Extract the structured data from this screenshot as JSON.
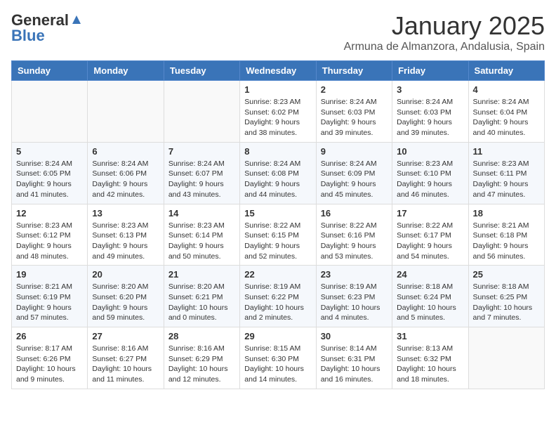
{
  "header": {
    "logo_general": "General",
    "logo_blue": "Blue",
    "month": "January 2025",
    "location": "Armuna de Almanzora, Andalusia, Spain"
  },
  "days_of_week": [
    "Sunday",
    "Monday",
    "Tuesday",
    "Wednesday",
    "Thursday",
    "Friday",
    "Saturday"
  ],
  "weeks": [
    [
      {
        "day": "",
        "info": ""
      },
      {
        "day": "",
        "info": ""
      },
      {
        "day": "",
        "info": ""
      },
      {
        "day": "1",
        "info": "Sunrise: 8:23 AM\nSunset: 6:02 PM\nDaylight: 9 hours and 38 minutes."
      },
      {
        "day": "2",
        "info": "Sunrise: 8:24 AM\nSunset: 6:03 PM\nDaylight: 9 hours and 39 minutes."
      },
      {
        "day": "3",
        "info": "Sunrise: 8:24 AM\nSunset: 6:03 PM\nDaylight: 9 hours and 39 minutes."
      },
      {
        "day": "4",
        "info": "Sunrise: 8:24 AM\nSunset: 6:04 PM\nDaylight: 9 hours and 40 minutes."
      }
    ],
    [
      {
        "day": "5",
        "info": "Sunrise: 8:24 AM\nSunset: 6:05 PM\nDaylight: 9 hours and 41 minutes."
      },
      {
        "day": "6",
        "info": "Sunrise: 8:24 AM\nSunset: 6:06 PM\nDaylight: 9 hours and 42 minutes."
      },
      {
        "day": "7",
        "info": "Sunrise: 8:24 AM\nSunset: 6:07 PM\nDaylight: 9 hours and 43 minutes."
      },
      {
        "day": "8",
        "info": "Sunrise: 8:24 AM\nSunset: 6:08 PM\nDaylight: 9 hours and 44 minutes."
      },
      {
        "day": "9",
        "info": "Sunrise: 8:24 AM\nSunset: 6:09 PM\nDaylight: 9 hours and 45 minutes."
      },
      {
        "day": "10",
        "info": "Sunrise: 8:23 AM\nSunset: 6:10 PM\nDaylight: 9 hours and 46 minutes."
      },
      {
        "day": "11",
        "info": "Sunrise: 8:23 AM\nSunset: 6:11 PM\nDaylight: 9 hours and 47 minutes."
      }
    ],
    [
      {
        "day": "12",
        "info": "Sunrise: 8:23 AM\nSunset: 6:12 PM\nDaylight: 9 hours and 48 minutes."
      },
      {
        "day": "13",
        "info": "Sunrise: 8:23 AM\nSunset: 6:13 PM\nDaylight: 9 hours and 49 minutes."
      },
      {
        "day": "14",
        "info": "Sunrise: 8:23 AM\nSunset: 6:14 PM\nDaylight: 9 hours and 50 minutes."
      },
      {
        "day": "15",
        "info": "Sunrise: 8:22 AM\nSunset: 6:15 PM\nDaylight: 9 hours and 52 minutes."
      },
      {
        "day": "16",
        "info": "Sunrise: 8:22 AM\nSunset: 6:16 PM\nDaylight: 9 hours and 53 minutes."
      },
      {
        "day": "17",
        "info": "Sunrise: 8:22 AM\nSunset: 6:17 PM\nDaylight: 9 hours and 54 minutes."
      },
      {
        "day": "18",
        "info": "Sunrise: 8:21 AM\nSunset: 6:18 PM\nDaylight: 9 hours and 56 minutes."
      }
    ],
    [
      {
        "day": "19",
        "info": "Sunrise: 8:21 AM\nSunset: 6:19 PM\nDaylight: 9 hours and 57 minutes."
      },
      {
        "day": "20",
        "info": "Sunrise: 8:20 AM\nSunset: 6:20 PM\nDaylight: 9 hours and 59 minutes."
      },
      {
        "day": "21",
        "info": "Sunrise: 8:20 AM\nSunset: 6:21 PM\nDaylight: 10 hours and 0 minutes."
      },
      {
        "day": "22",
        "info": "Sunrise: 8:19 AM\nSunset: 6:22 PM\nDaylight: 10 hours and 2 minutes."
      },
      {
        "day": "23",
        "info": "Sunrise: 8:19 AM\nSunset: 6:23 PM\nDaylight: 10 hours and 4 minutes."
      },
      {
        "day": "24",
        "info": "Sunrise: 8:18 AM\nSunset: 6:24 PM\nDaylight: 10 hours and 5 minutes."
      },
      {
        "day": "25",
        "info": "Sunrise: 8:18 AM\nSunset: 6:25 PM\nDaylight: 10 hours and 7 minutes."
      }
    ],
    [
      {
        "day": "26",
        "info": "Sunrise: 8:17 AM\nSunset: 6:26 PM\nDaylight: 10 hours and 9 minutes."
      },
      {
        "day": "27",
        "info": "Sunrise: 8:16 AM\nSunset: 6:27 PM\nDaylight: 10 hours and 11 minutes."
      },
      {
        "day": "28",
        "info": "Sunrise: 8:16 AM\nSunset: 6:29 PM\nDaylight: 10 hours and 12 minutes."
      },
      {
        "day": "29",
        "info": "Sunrise: 8:15 AM\nSunset: 6:30 PM\nDaylight: 10 hours and 14 minutes."
      },
      {
        "day": "30",
        "info": "Sunrise: 8:14 AM\nSunset: 6:31 PM\nDaylight: 10 hours and 16 minutes."
      },
      {
        "day": "31",
        "info": "Sunrise: 8:13 AM\nSunset: 6:32 PM\nDaylight: 10 hours and 18 minutes."
      },
      {
        "day": "",
        "info": ""
      }
    ]
  ]
}
